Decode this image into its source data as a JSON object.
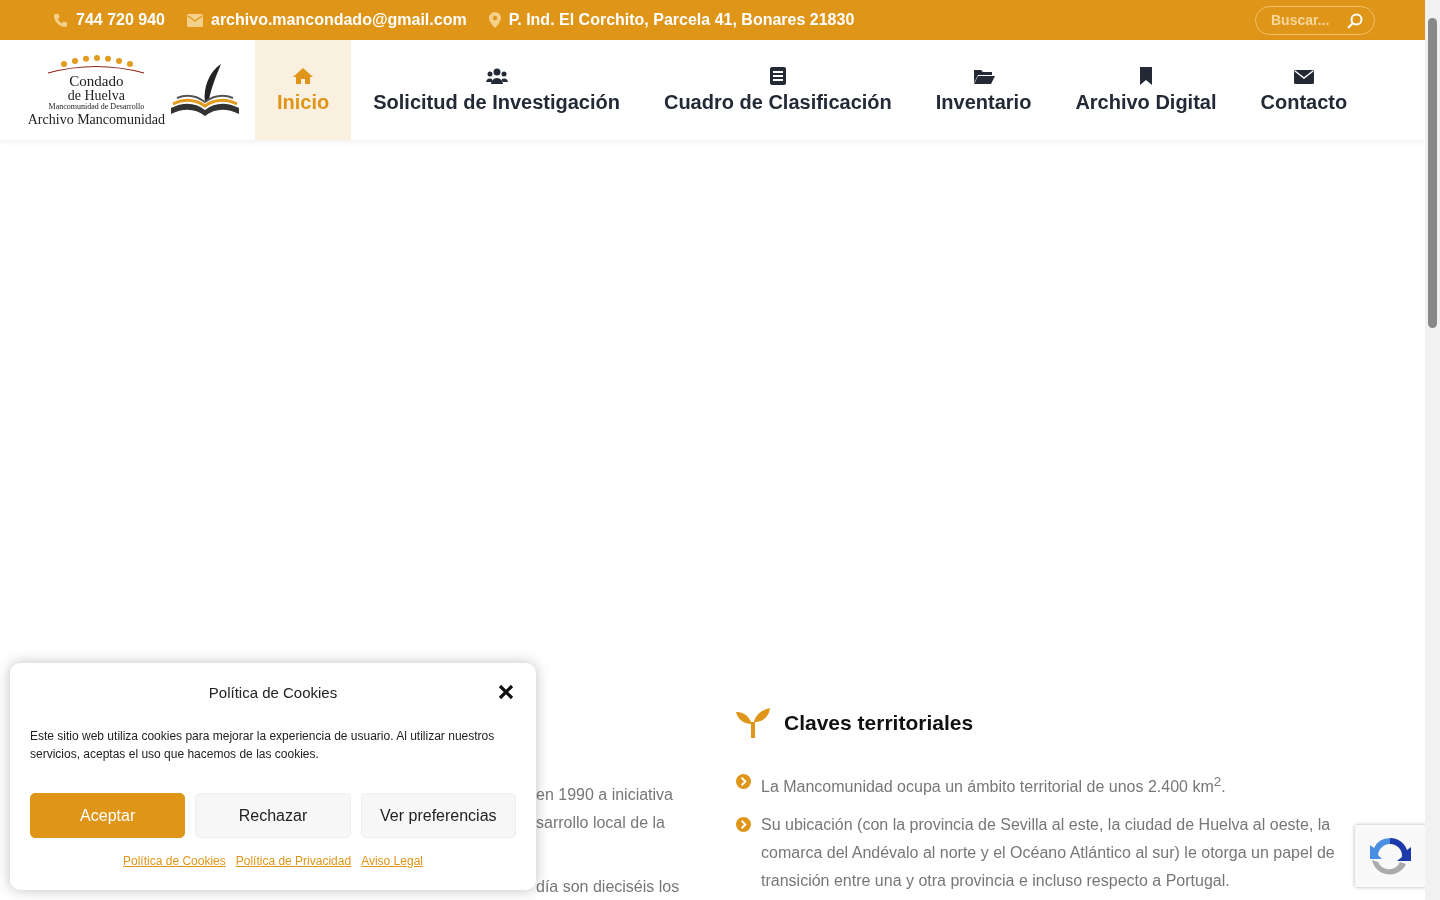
{
  "top_bar": {
    "phone": "744 720 940",
    "email": "archivo.mancondado@gmail.com",
    "address": "P. Ind. El Corchito, Parcela 41, Bonares 21830",
    "search": {
      "placeholder": "Buscar..."
    }
  },
  "logo": {
    "line_1": "Condado",
    "line_2": "de Huelva",
    "line_3": "Mancomunidad de Desarrollo",
    "line_4": "Archivo Mancomunidad"
  },
  "nav": [
    {
      "label": "Inicio",
      "selected": true
    },
    {
      "label": "Solicitud de Investigación",
      "selected": false
    },
    {
      "label": "Cuadro de Clasificación",
      "selected": false
    },
    {
      "label": "Inventario",
      "selected": false
    },
    {
      "label": "Archivo Digital",
      "selected": false
    },
    {
      "label": "Contacto",
      "selected": false
    }
  ],
  "left_column": {
    "lines": [
      "en 1990 a iniciativa",
      "sarrollo local de la",
      "día son dieciséis los"
    ]
  },
  "right_column": {
    "heading": "Claves territoriales",
    "items": [
      "La Mancomunidad ocupa un ámbito territorial de unos 2.400 km$^{2}$.",
      "Su ubicación (con la provincia de Sevilla al este, la ciudad de Huelva al oeste, la comarca del Andévalo al norte y el Océano Atlántico al sur) le otorga un papel de transición entre una y otra provincia e incluso respecto a Portugal."
    ]
  },
  "cookie_dialog": {
    "title": "Política de Cookies",
    "text": "Este sitio web utiliza cookies para mejorar la experiencia de usuario. Al utilizar nuestros servicios, aceptas el uso que hacemos de las cookies.",
    "buttons": [
      {
        "label": "Aceptar",
        "kind": "primary"
      },
      {
        "label": "Rechazar",
        "kind": "secondary"
      },
      {
        "label": "Ver preferencias",
        "kind": "secondary"
      }
    ],
    "links": [
      "Política de Cookies",
      "Política de Privacidad",
      "Aviso Legal"
    ]
  }
}
